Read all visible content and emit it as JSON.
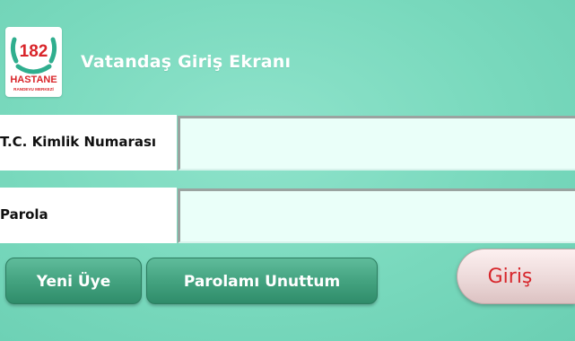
{
  "header": {
    "title": "Vatandaş Giriş Ekranı",
    "logo": {
      "number": "182",
      "name": "HASTANE",
      "subtitle": "RANDEVU MERKEZİ"
    }
  },
  "form": {
    "tc": {
      "label": "T.C. Kimlik Numarası",
      "value": ""
    },
    "password": {
      "label": "Parola",
      "value": ""
    }
  },
  "buttons": {
    "new_member": "Yeni Üye",
    "forgot_password": "Parolamı Unuttum",
    "login": "Giriş"
  },
  "colors": {
    "background": "#79d9bd",
    "button_green": "#44a380",
    "login_text": "#d7262b",
    "logo_red": "#d9252a"
  }
}
